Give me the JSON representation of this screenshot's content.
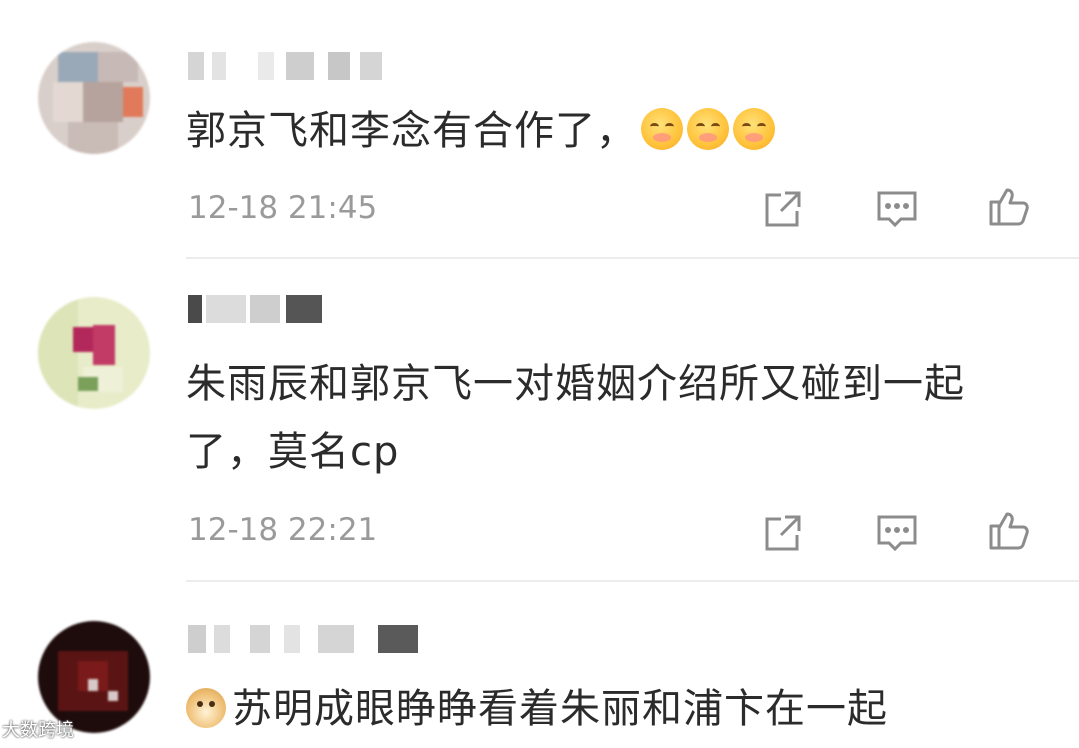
{
  "comments": [
    {
      "text": "郭京飞和李念有合作了，",
      "emoji": [
        "blush-emoji",
        "blush-emoji",
        "blush-emoji"
      ],
      "time": "12-18 21:45",
      "avatar_colors": [
        "#c7b9b6",
        "#9aa9b8",
        "#e3d8d2",
        "#b7a39d"
      ]
    },
    {
      "text": "朱雨辰和郭京飞一对婚姻介绍所又碰到一起了，莫名cp",
      "time": "12-18 22:21",
      "avatar_colors": [
        "#e8ecc8",
        "#b3285a",
        "#d9e2b6",
        "#7aa05a"
      ]
    },
    {
      "prefix_emoji": "doge-emoji",
      "text": "苏明成眼睁睁看着朱丽和浦卞在一起",
      "avatar_colors": [
        "#1e0b0b",
        "#7a1a1a",
        "#3a1010",
        "#d8c9c9"
      ]
    }
  ],
  "actions": {
    "icons": [
      "share-icon",
      "reply-icon",
      "like-icon"
    ]
  },
  "watermark": "大数跨境",
  "colors": {
    "text": "#2b2b2b",
    "meta": "#9a9a9a",
    "icon": "#8c8c8c",
    "divider": "#ececec"
  }
}
